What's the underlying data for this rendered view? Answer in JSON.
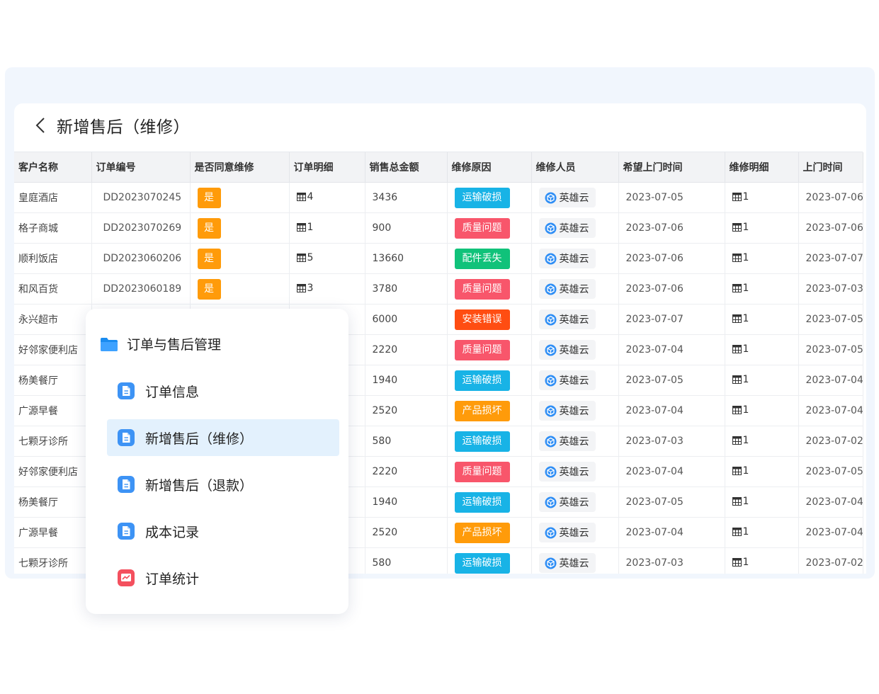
{
  "page": {
    "title": "新增售后（维修）",
    "back_icon": "chevron-left-icon"
  },
  "colors": {
    "yes": "#ff9b0a",
    "运输破损": "#18b3e6",
    "质量问题": "#f8566b",
    "配件丢失": "#10c27a",
    "安装错误": "#ff4d12",
    "产品损坏": "#ff9b0a",
    "menu_active_bg": "#e3f1fd"
  },
  "table": {
    "columns": [
      "客户名称",
      "订单编号",
      "是否同意维修",
      "订单明细",
      "销售总金额",
      "维修原因",
      "维修人员",
      "希望上门时间",
      "维修明细",
      "上门时间"
    ],
    "rows": [
      {
        "customer": "皇庭酒店",
        "order_no": "DD2023070245",
        "agree": "是",
        "detail": "4",
        "total": "3436",
        "reason": "运输破损",
        "person": "英雄云",
        "wish_date": "2023-07-05",
        "repair_detail": "1",
        "visit_date": "2023-07-06"
      },
      {
        "customer": "格子商城",
        "order_no": "DD2023070269",
        "agree": "是",
        "detail": "1",
        "total": "900",
        "reason": "质量问题",
        "person": "英雄云",
        "wish_date": "2023-07-06",
        "repair_detail": "1",
        "visit_date": "2023-07-06"
      },
      {
        "customer": "顺利饭店",
        "order_no": "DD2023060206",
        "agree": "是",
        "detail": "5",
        "total": "13660",
        "reason": "配件丢失",
        "person": "英雄云",
        "wish_date": "2023-07-06",
        "repair_detail": "1",
        "visit_date": "2023-07-07"
      },
      {
        "customer": "和风百货",
        "order_no": "DD2023060189",
        "agree": "是",
        "detail": "3",
        "total": "3780",
        "reason": "质量问题",
        "person": "英雄云",
        "wish_date": "2023-07-06",
        "repair_detail": "1",
        "visit_date": "2023-07-03"
      },
      {
        "customer": "永兴超市",
        "order_no": "",
        "agree": "",
        "detail": "",
        "total": "6000",
        "reason": "安装错误",
        "person": "英雄云",
        "wish_date": "2023-07-07",
        "repair_detail": "1",
        "visit_date": "2023-07-05"
      },
      {
        "customer": "好邻家便利店",
        "order_no": "",
        "agree": "",
        "detail": "",
        "total": "2220",
        "reason": "质量问题",
        "person": "英雄云",
        "wish_date": "2023-07-04",
        "repair_detail": "1",
        "visit_date": "2023-07-05"
      },
      {
        "customer": "杨美餐厅",
        "order_no": "",
        "agree": "",
        "detail": "",
        "total": "1940",
        "reason": "运输破损",
        "person": "英雄云",
        "wish_date": "2023-07-05",
        "repair_detail": "1",
        "visit_date": "2023-07-04"
      },
      {
        "customer": "广源早餐",
        "order_no": "",
        "agree": "",
        "detail": "",
        "total": "2520",
        "reason": "产品损坏",
        "person": "英雄云",
        "wish_date": "2023-07-04",
        "repair_detail": "1",
        "visit_date": "2023-07-04"
      },
      {
        "customer": "七颗牙诊所",
        "order_no": "",
        "agree": "",
        "detail": "",
        "total": "580",
        "reason": "运输破损",
        "person": "英雄云",
        "wish_date": "2023-07-03",
        "repair_detail": "1",
        "visit_date": "2023-07-02"
      },
      {
        "customer": "好邻家便利店",
        "order_no": "",
        "agree": "",
        "detail": "",
        "total": "2220",
        "reason": "质量问题",
        "person": "英雄云",
        "wish_date": "2023-07-04",
        "repair_detail": "1",
        "visit_date": "2023-07-05"
      },
      {
        "customer": "杨美餐厅",
        "order_no": "",
        "agree": "",
        "detail": "",
        "total": "1940",
        "reason": "运输破损",
        "person": "英雄云",
        "wish_date": "2023-07-05",
        "repair_detail": "1",
        "visit_date": "2023-07-04"
      },
      {
        "customer": "广源早餐",
        "order_no": "",
        "agree": "",
        "detail": "",
        "total": "2520",
        "reason": "产品损坏",
        "person": "英雄云",
        "wish_date": "2023-07-04",
        "repair_detail": "1",
        "visit_date": "2023-07-04"
      },
      {
        "customer": "七颗牙诊所",
        "order_no": "",
        "agree": "",
        "detail": "",
        "total": "580",
        "reason": "运输破损",
        "person": "英雄云",
        "wish_date": "2023-07-03",
        "repair_detail": "1",
        "visit_date": "2023-07-02"
      }
    ]
  },
  "menu": {
    "group_label": "订单与售后管理",
    "group_icon": "folder-icon",
    "items": [
      {
        "label": "订单信息",
        "icon": "document-icon",
        "active": false
      },
      {
        "label": "新增售后（维修）",
        "icon": "document-icon",
        "active": true
      },
      {
        "label": "新增售后（退款）",
        "icon": "document-icon",
        "active": false
      },
      {
        "label": "成本记录",
        "icon": "document-icon",
        "active": false
      },
      {
        "label": "订单统计",
        "icon": "chart-icon",
        "active": false
      }
    ]
  }
}
